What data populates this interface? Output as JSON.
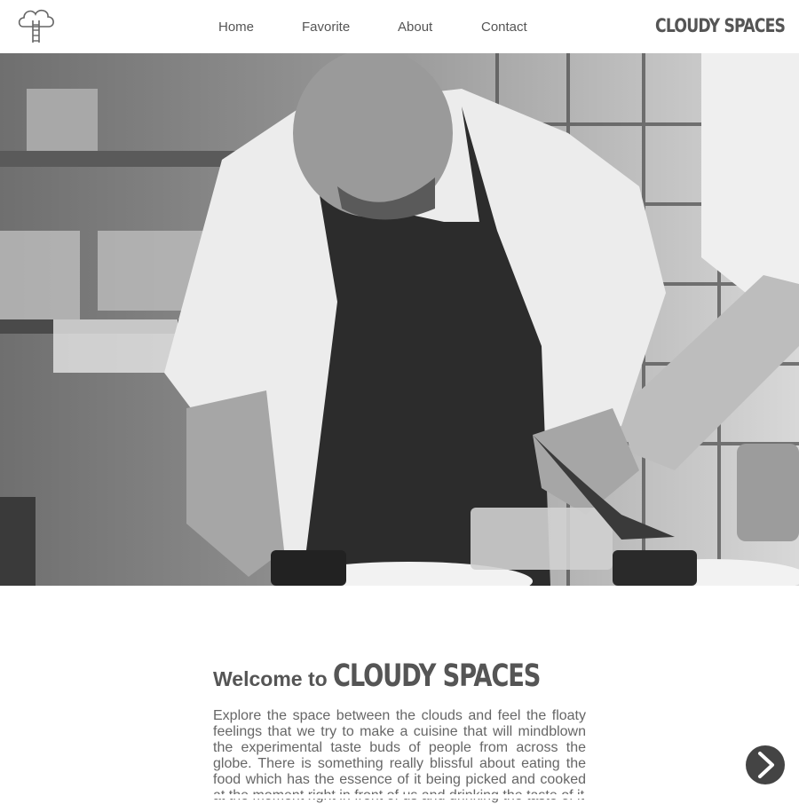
{
  "header": {
    "logo_icon": "cloud-ladder-icon",
    "nav": [
      {
        "label": "Home"
      },
      {
        "label": "Favorite"
      },
      {
        "label": "About"
      },
      {
        "label": "Contact"
      }
    ],
    "brand": "CLOUDY SPACES"
  },
  "hero": {
    "image": "black-and-white photo of a chef in apron plating food in a kitchen"
  },
  "welcome": {
    "prefix": "Welcome to",
    "brand": "CLOUDY SPACES",
    "text": "Explore the space between the clouds and feel the floaty feelings that we try to make a cuisine that will mindblown the experimental taste buds of people from across the globe. There is something really blissful about eating the food which has the essence of it being picked and cooked at the moment right in front of us and drinking the taste of it"
  },
  "next_button": {
    "icon": "chevron-right-icon"
  },
  "colors": {
    "text": "#555555",
    "button": "#444444",
    "background": "#ffffff"
  }
}
